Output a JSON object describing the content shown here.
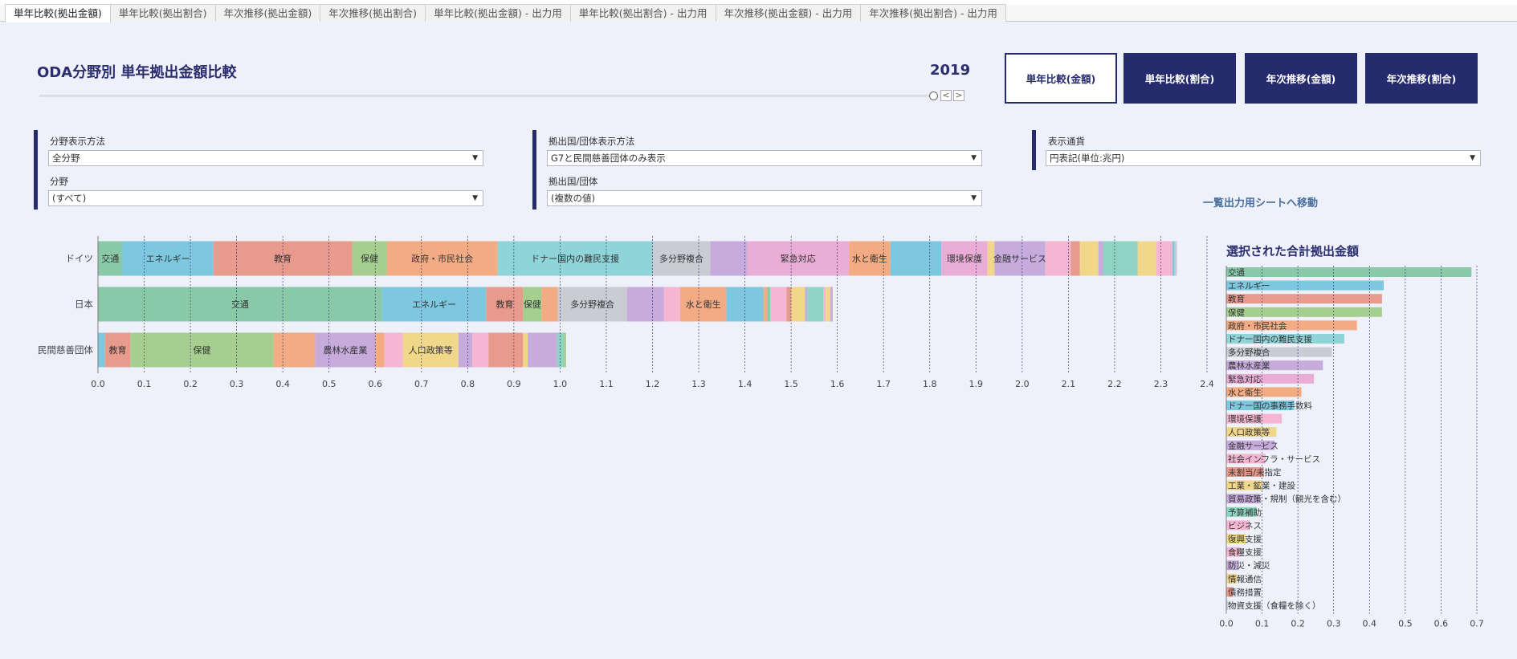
{
  "tabs": [
    {
      "label": "単年比較(拠出金額)",
      "active": true
    },
    {
      "label": "単年比較(拠出割合)",
      "active": false
    },
    {
      "label": "年次推移(拠出金額)",
      "active": false
    },
    {
      "label": "年次推移(拠出割合)",
      "active": false
    },
    {
      "label": "単年比較(拠出金額) - 出力用",
      "active": false
    },
    {
      "label": "単年比較(拠出割合) - 出力用",
      "active": false
    },
    {
      "label": "年次推移(拠出金額) - 出力用",
      "active": false
    },
    {
      "label": "年次推移(拠出割合) - 出力用",
      "active": false
    }
  ],
  "header": {
    "title": "ODA分野別 単年拠出金額比較",
    "year": "2019",
    "prev_symbol": "<",
    "next_symbol": ">"
  },
  "nav_buttons": [
    {
      "label": "単年比較(金額)",
      "active": true
    },
    {
      "label": "単年比較(割合)",
      "active": false
    },
    {
      "label": "年次推移(金額)",
      "active": false
    },
    {
      "label": "年次推移(割合)",
      "active": false
    }
  ],
  "filters": {
    "field_display_label": "分野表示方法",
    "field_display_value": "全分野",
    "field_label": "分野",
    "field_value": "(すべて)",
    "donor_display_label": "拠出国/団体表示方法",
    "donor_display_value": "G7と民間慈善団体のみ表示",
    "donor_label": "拠出国/団体",
    "donor_value": "(複数の値)",
    "currency_label": "表示通貨",
    "currency_value": "円表記(単位:兆円)",
    "caret": "▼"
  },
  "link_move": "一覧出力用シートへ移動",
  "icons": {
    "dropdown": "caret-down-icon"
  },
  "colors": {
    "nav_bg": "#262b6e",
    "title": "#2b2f6f",
    "page_bg": "#eef0fa"
  },
  "chart_data": [
    {
      "type": "bar",
      "orientation": "horizontal-stacked",
      "title": "",
      "xlabel": "",
      "ylabel": "",
      "xlim": [
        0,
        2.4
      ],
      "xticks": [
        0.0,
        0.1,
        0.2,
        0.3,
        0.4,
        0.5,
        0.6,
        0.7,
        0.8,
        0.9,
        1.0,
        1.1,
        1.2,
        1.3,
        1.4,
        1.5,
        1.6,
        1.7,
        1.8,
        1.9,
        2.0,
        2.1,
        2.2,
        2.3,
        2.4
      ],
      "xtick_labels": [
        "0.0",
        "0.1",
        "0.2",
        "0.3",
        "0.4",
        "0.5",
        "0.6",
        "0.7",
        "0.8",
        "0.9",
        "1.0",
        "1.1",
        "1.2",
        "1.3",
        "1.4",
        "1.5",
        "1.6",
        "1.7",
        "1.8",
        "1.9",
        "2.0",
        "2.1",
        "2.2",
        "2.3",
        "2.4"
      ],
      "grid": true,
      "categories": [
        "ドイツ",
        "日本",
        "民間慈善団体"
      ],
      "bars": [
        {
          "category": "ドイツ",
          "segments": [
            {
              "label": "交通",
              "value": 0.053,
              "color": "#89c9a8"
            },
            {
              "label": "エネルギー",
              "value": 0.197,
              "color": "#7ec8df"
            },
            {
              "label": "教育",
              "value": 0.3,
              "color": "#e89a8c"
            },
            {
              "label": "保健",
              "value": 0.075,
              "color": "#a6cf8f"
            },
            {
              "label": "政府・市民社会",
              "value": 0.24,
              "color": "#f2ab82"
            },
            {
              "label": "ドナー国内の難民支援",
              "value": 0.335,
              "color": "#8fd4d9"
            },
            {
              "label": "多分野複合",
              "value": 0.125,
              "color": "#c9ccd2"
            },
            {
              "label": "",
              "value": 0.08,
              "color": "#c6abdc"
            },
            {
              "label": "緊急対応",
              "value": 0.22,
              "color": "#eaaed6"
            },
            {
              "label": "水と衛生",
              "value": 0.09,
              "color": "#f2ab82"
            },
            {
              "label": "",
              "value": 0.11,
              "color": "#7ec8df"
            },
            {
              "label": "環境保護",
              "value": 0.1,
              "color": "#eaaed6"
            },
            {
              "label": "",
              "value": 0.015,
              "color": "#f0d78a"
            },
            {
              "label": "金融サービス",
              "value": 0.11,
              "color": "#c6abdc"
            },
            {
              "label": "",
              "value": 0.055,
              "color": "#f5b6d1"
            },
            {
              "label": "",
              "value": 0.02,
              "color": "#e89a8c"
            },
            {
              "label": "",
              "value": 0.04,
              "color": "#f0d78a"
            },
            {
              "label": "",
              "value": 0.01,
              "color": "#c6abdc"
            },
            {
              "label": "",
              "value": 0.075,
              "color": "#8fd4c3"
            },
            {
              "label": "",
              "value": 0.04,
              "color": "#f0d78a"
            },
            {
              "label": "",
              "value": 0.035,
              "color": "#f5b6d1"
            },
            {
              "label": "",
              "value": 0.005,
              "color": "#7ec8df"
            },
            {
              "label": "",
              "value": 0.005,
              "color": "#c9ccd2"
            }
          ]
        },
        {
          "category": "日本",
          "segments": [
            {
              "label": "交通",
              "value": 0.615,
              "color": "#89c9a8"
            },
            {
              "label": "エネルギー",
              "value": 0.225,
              "color": "#7ec8df"
            },
            {
              "label": "教育",
              "value": 0.08,
              "color": "#e89a8c"
            },
            {
              "label": "保健",
              "value": 0.04,
              "color": "#a6cf8f"
            },
            {
              "label": "",
              "value": 0.035,
              "color": "#f2ab82"
            },
            {
              "label": "多分野複合",
              "value": 0.15,
              "color": "#c9ccd2"
            },
            {
              "label": "",
              "value": 0.08,
              "color": "#c6abdc"
            },
            {
              "label": "",
              "value": 0.035,
              "color": "#f5b6d1"
            },
            {
              "label": "水と衛生",
              "value": 0.1,
              "color": "#f2ab82"
            },
            {
              "label": "",
              "value": 0.08,
              "color": "#7ec8df"
            },
            {
              "label": "",
              "value": 0.008,
              "color": "#f2ab82"
            },
            {
              "label": "",
              "value": 0.007,
              "color": "#89c9a8"
            },
            {
              "label": "",
              "value": 0.035,
              "color": "#f5b6d1"
            },
            {
              "label": "",
              "value": 0.01,
              "color": "#e89a8c"
            },
            {
              "label": "",
              "value": 0.03,
              "color": "#f0d78a"
            },
            {
              "label": "",
              "value": 0.005,
              "color": "#c6abdc"
            },
            {
              "label": "",
              "value": 0.035,
              "color": "#8fd4c3"
            },
            {
              "label": "",
              "value": 0.005,
              "color": "#f5b6d1"
            },
            {
              "label": "",
              "value": 0.01,
              "color": "#f0d78a"
            },
            {
              "label": "",
              "value": 0.005,
              "color": "#c6abdc"
            }
          ]
        },
        {
          "category": "民間慈善団体",
          "segments": [
            {
              "label": "",
              "value": 0.015,
              "color": "#7ec8df"
            },
            {
              "label": "教育",
              "value": 0.055,
              "color": "#e89a8c"
            },
            {
              "label": "保健",
              "value": 0.31,
              "color": "#a6cf8f"
            },
            {
              "label": "",
              "value": 0.09,
              "color": "#f2ab82"
            },
            {
              "label": "農林水産業",
              "value": 0.13,
              "color": "#c6abdc"
            },
            {
              "label": "",
              "value": 0.02,
              "color": "#f2ab82"
            },
            {
              "label": "",
              "value": 0.04,
              "color": "#f5b6d1"
            },
            {
              "label": "人口政策等",
              "value": 0.12,
              "color": "#f0d78a"
            },
            {
              "label": "",
              "value": 0.03,
              "color": "#c6abdc"
            },
            {
              "label": "",
              "value": 0.035,
              "color": "#f5b6d1"
            },
            {
              "label": "",
              "value": 0.075,
              "color": "#e89a8c"
            },
            {
              "label": "",
              "value": 0.01,
              "color": "#f0d78a"
            },
            {
              "label": "",
              "value": 0.063,
              "color": "#c6abdc"
            },
            {
              "label": "",
              "value": 0.015,
              "color": "#8fd4c3"
            },
            {
              "label": "",
              "value": 0.005,
              "color": "#a6cf8f"
            }
          ]
        }
      ]
    },
    {
      "type": "bar",
      "orientation": "horizontal",
      "title": "選択された合計拠出金額",
      "xlabel": "",
      "ylabel": "",
      "xlim": [
        0,
        0.7
      ],
      "xticks": [
        0.0,
        0.1,
        0.2,
        0.3,
        0.4,
        0.5,
        0.6,
        0.7
      ],
      "xtick_labels": [
        "0.0",
        "0.1",
        "0.2",
        "0.3",
        "0.4",
        "0.5",
        "0.6",
        "0.7"
      ],
      "grid": true,
      "categories": [
        "交通",
        "エネルギー",
        "教育",
        "保健",
        "政府・市民社会",
        "ドナー国内の難民支援",
        "多分野複合",
        "農林水産業",
        "緊急対応",
        "水と衛生",
        "ドナー国の事務手数料",
        "環境保護",
        "人口政策等",
        "金融サービス",
        "社会インフラ・サービス",
        "未割当/未指定",
        "工業・鉱業・建設",
        "貿易政策・規制（観光を含む）",
        "予算補助",
        "ビジネス",
        "復興支援",
        "食糧支援",
        "防災・減災",
        "情報通信",
        "債務措置",
        "物資支援（食糧を除く）"
      ],
      "values": [
        0.685,
        0.44,
        0.435,
        0.435,
        0.365,
        0.33,
        0.295,
        0.27,
        0.245,
        0.21,
        0.19,
        0.155,
        0.14,
        0.135,
        0.11,
        0.105,
        0.1,
        0.095,
        0.085,
        0.065,
        0.055,
        0.04,
        0.035,
        0.03,
        0.02,
        0.005
      ],
      "colors": [
        "#89c9a8",
        "#7ec8df",
        "#e89a8c",
        "#a6cf8f",
        "#f2ab82",
        "#8fd4d9",
        "#c9ccd2",
        "#c6abdc",
        "#eaaed6",
        "#f2ab82",
        "#7ec8df",
        "#f5b6d1",
        "#f0d78a",
        "#c6abdc",
        "#f5b6d1",
        "#e89a8c",
        "#f0d78a",
        "#c6abdc",
        "#8fd4c3",
        "#f5b6d1",
        "#f0d78a",
        "#f5b6d1",
        "#c6abdc",
        "#f0d78a",
        "#e89a8c",
        "#c9ccd2"
      ]
    }
  ]
}
